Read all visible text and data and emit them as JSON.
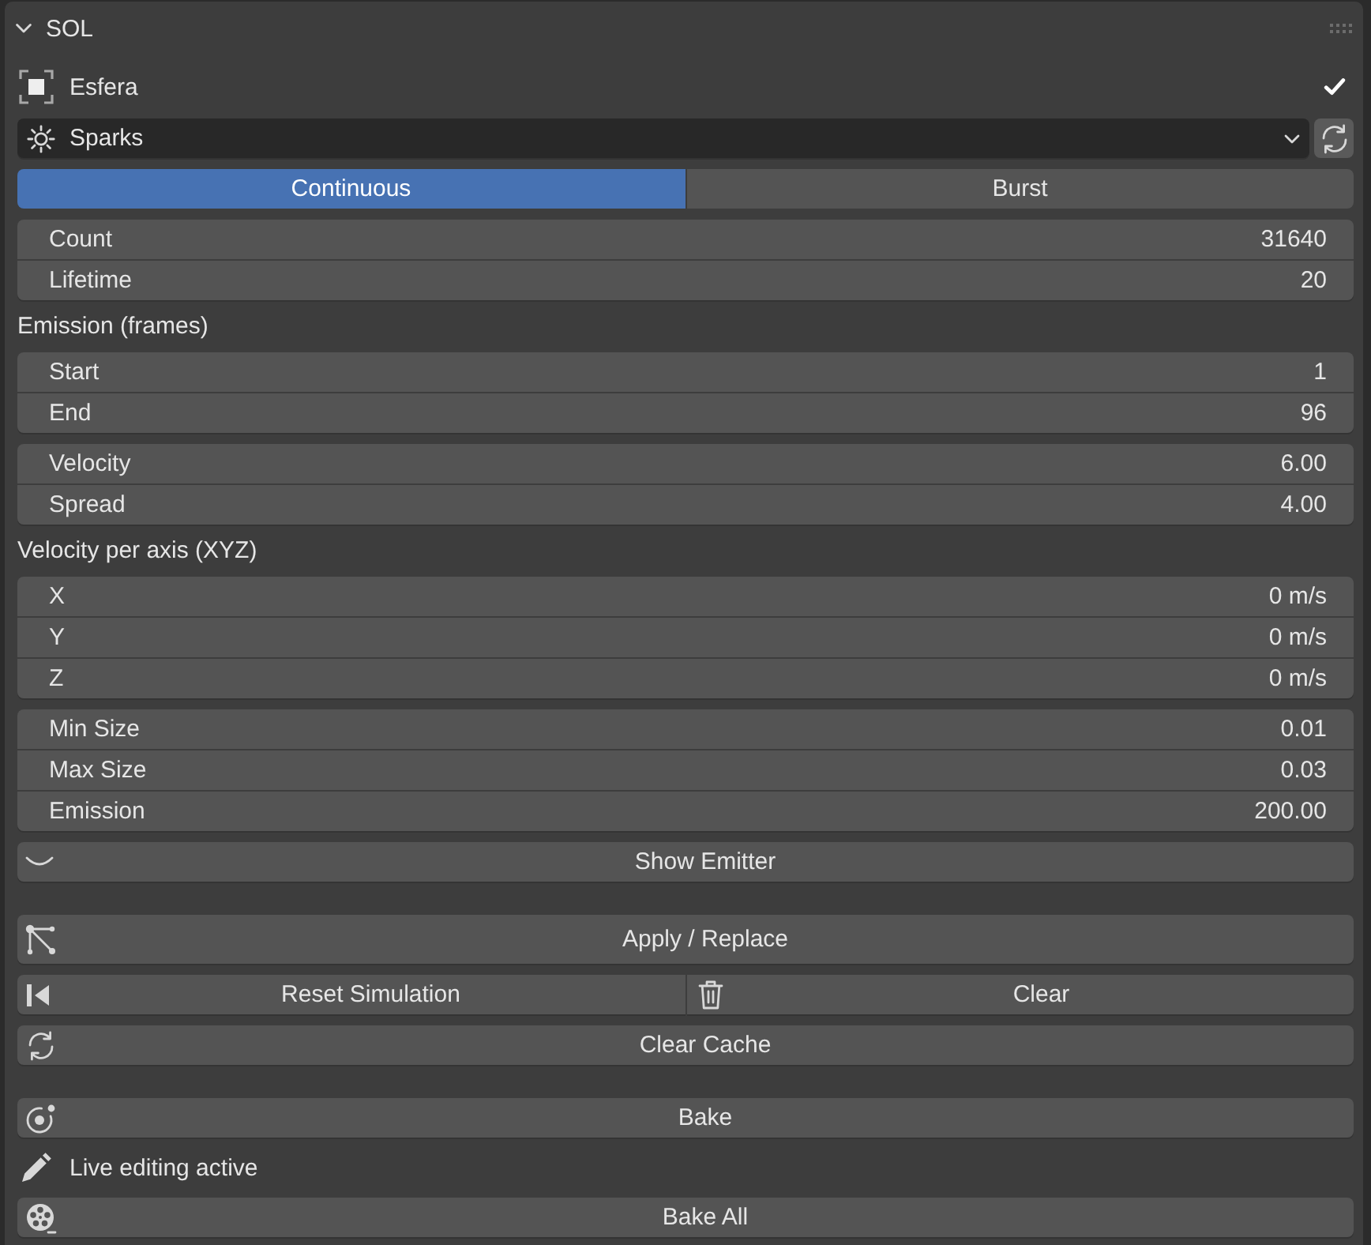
{
  "panel": {
    "title": "SOL",
    "expanded": true
  },
  "sections": [
    {
      "rows": [
        {
          "kind": "object",
          "label": "Esfera",
          "checked": true
        },
        {
          "kind": "dropdown",
          "value": "Sparks"
        },
        {
          "kind": "tabs",
          "tabs": [
            {
              "label": "Continuous",
              "selected": true
            },
            {
              "label": "Burst",
              "selected": false
            }
          ]
        },
        {
          "kind": "fields",
          "fields": [
            {
              "label": "Count",
              "value": "31640"
            },
            {
              "label": "Lifetime",
              "value": "20"
            }
          ]
        },
        {
          "kind": "heading",
          "text": "Emission (frames)"
        },
        {
          "kind": "fields",
          "fields": [
            {
              "label": "Start",
              "value": "1"
            },
            {
              "label": "End",
              "value": "96"
            }
          ]
        },
        {
          "kind": "fields",
          "fields": [
            {
              "label": "Velocity",
              "value": "6.00"
            },
            {
              "label": "Spread",
              "value": "4.00"
            }
          ]
        },
        {
          "kind": "heading",
          "text": "Velocity per axis (XYZ)"
        },
        {
          "kind": "fields",
          "fields": [
            {
              "label": "X",
              "value": "0 m/s"
            },
            {
              "label": "Y",
              "value": "0 m/s"
            },
            {
              "label": "Z",
              "value": "0 m/s"
            }
          ]
        },
        {
          "kind": "fields",
          "fields": [
            {
              "label": "Min Size",
              "value": "0.01"
            },
            {
              "label": "Max Size",
              "value": "0.03"
            },
            {
              "label": "Emission",
              "value": "200.00"
            }
          ]
        },
        {
          "kind": "toggle",
          "label": "Show Emitter",
          "on": false
        }
      ]
    },
    {
      "rows": [
        {
          "kind": "large_button",
          "label": "Apply / Replace"
        },
        {
          "kind": "button_pair",
          "buttons": [
            {
              "label": "Reset Simulation"
            },
            {
              "label": "Clear"
            }
          ]
        },
        {
          "kind": "button",
          "label": "Clear Cache"
        }
      ]
    },
    {
      "rows": [
        {
          "kind": "button",
          "label": "Bake"
        },
        {
          "kind": "status",
          "text": "Live editing active"
        },
        {
          "kind": "button",
          "label": "Bake All"
        }
      ]
    }
  ]
}
